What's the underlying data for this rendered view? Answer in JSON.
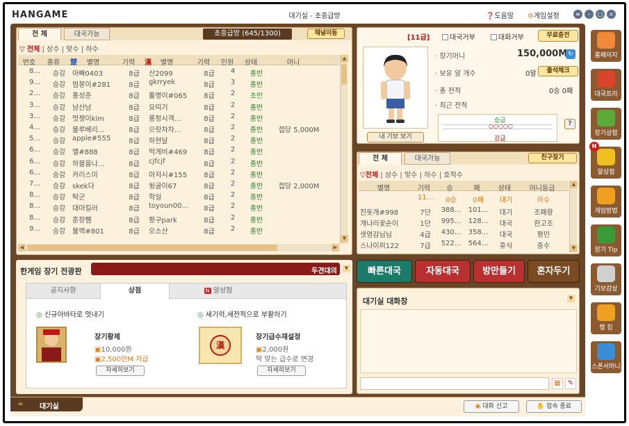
{
  "app": {
    "logo": "HANGAME",
    "title": "대기실 - 초중급방",
    "help": "도움말",
    "settings": "게임설정"
  },
  "lobby": {
    "tab_all": "전 체",
    "tab_available": "대국가능",
    "room_info": "초중급방 (645/1300)",
    "channel_move_btn": "채널이동",
    "filters": [
      "전체",
      "상수",
      "맞수",
      "하수"
    ],
    "headers": [
      "번호",
      "종류",
      "楚",
      "별명",
      "기력",
      "漢",
      "별명",
      "기력",
      "인원",
      "상태",
      "머니"
    ],
    "rows": [
      [
        "8...",
        "승강",
        "아빠0403",
        "8급",
        "산2099",
        "8급",
        "4",
        "종반",
        ""
      ],
      [
        "9...",
        "승강",
        "멈붕이#281",
        "8급",
        "gkrryek",
        "8급",
        "3",
        "종반",
        ""
      ],
      [
        "2...",
        "승강",
        "홍성준",
        "8급",
        "톨명이#065",
        "8급",
        "2",
        "초반",
        ""
      ],
      [
        "3...",
        "승강",
        "남산남",
        "8급",
        "요띠기",
        "8급",
        "2",
        "종반",
        ""
      ],
      [
        "3...",
        "승강",
        "멋쟁이kim",
        "8급",
        "룡정시객...",
        "8급",
        "2",
        "종반",
        ""
      ],
      [
        "4...",
        "승강",
        "볼루베리...",
        "8급",
        "으랏차차...",
        "8급",
        "2",
        "종반",
        "접당 5,000M"
      ],
      [
        "5...",
        "승강",
        "apple#555",
        "8급",
        "하현달",
        "8급",
        "2",
        "종반",
        ""
      ],
      [
        "6...",
        "승강",
        "엘#888",
        "8급",
        "먹게비#469",
        "8급",
        "2",
        "종반",
        ""
      ],
      [
        "6...",
        "승강",
        "하블을나...",
        "8급",
        "cjfcjf",
        "8급",
        "2",
        "종반",
        ""
      ],
      [
        "6...",
        "승강",
        "카리스미",
        "8급",
        "아저시#155",
        "8급",
        "2",
        "종반",
        ""
      ],
      [
        "7...",
        "승강",
        "skek다",
        "8급",
        "뒹굴이67",
        "8급",
        "2",
        "종반",
        "접당 2,000M"
      ],
      [
        "8...",
        "승강",
        "탁군",
        "8급",
        "학일",
        "8급",
        "2",
        "종반",
        ""
      ],
      [
        "8...",
        "승강",
        "대마킬러",
        "8급",
        "toyoun00...",
        "8급",
        "2",
        "종반",
        ""
      ],
      [
        "8...",
        "승강",
        "훈장쨈",
        "8급",
        "팡구park",
        "8급",
        "2",
        "종반",
        ""
      ],
      [
        "9...",
        "승강",
        "불랙#801",
        "8급",
        "오소산",
        "8급",
        "2",
        "종반",
        ""
      ]
    ]
  },
  "profile": {
    "rank": "[11급]",
    "no_game": "대국거부",
    "no_chat": "대화거부",
    "free_charge": "무료충전",
    "money_label": "장기머니",
    "money_value": "150,000M",
    "egg_label": "보유 알 개수",
    "egg_value": "0알",
    "attendance": "출석체크",
    "total_label": "총 전적",
    "total_value": "0승 0패",
    "recent_label": "최근 전적",
    "my_info": "내 기보 보기",
    "promote": "승급",
    "demote": "강급",
    "q": "?"
  },
  "users": {
    "tab_all": "전 체",
    "tab_available": "대국가능",
    "find_friend": "친구찾기",
    "filters": [
      "전체",
      "상수",
      "맞수",
      "하수",
      "호적수"
    ],
    "headers": [
      "별명",
      "기력",
      "승",
      "패",
      "상태",
      "머니등급"
    ],
    "self_row": [
      "",
      "11...",
      "0승",
      "0패",
      "대기",
      "하수"
    ],
    "rows": [
      [
        "진돗개#998",
        "7단",
        "388...",
        "101...",
        "대기",
        "조패왕"
      ],
      [
        "개나리꽃순이",
        "1단",
        "995...",
        "128...",
        "대국",
        "한고조"
      ],
      [
        "샛영감님님",
        "4급",
        "430...",
        "358...",
        "대국",
        "평민"
      ],
      [
        "스나이퍼122",
        "7급",
        "522...",
        "564...",
        "휴식",
        "중수"
      ]
    ]
  },
  "actions": {
    "quick": "빠른대국",
    "auto": "자동대국",
    "make_room": "방만들기",
    "solo": "혼자두기"
  },
  "chat": {
    "title": "대기실 대화창"
  },
  "board": {
    "title": "한게임 장기 전광판",
    "ticker": "두견대의",
    "tabs": [
      "공지사항",
      "상점",
      "알상점"
    ],
    "promo1": "신규아바타로 멋내기",
    "promo2": "새기력,새전적으로 부활하기",
    "item1": {
      "name": "장기황제",
      "price": "10,000원",
      "price2": "2,500만M 지급",
      "detail": "자세히보기"
    },
    "item2": {
      "name": "장기급수재설정",
      "price": "2,000원",
      "desc": "딱 맞는 급수로 변경",
      "detail": "자세히보기"
    }
  },
  "sidebar": [
    "홈페이지",
    "대국프리",
    "장기상점",
    "알상점",
    "게임방법",
    "장기 Tip",
    "기보감상",
    "랭 킹",
    "스폰서머니"
  ],
  "bottom": {
    "lobby": "대기실",
    "report": "대화 신고",
    "exit": "접속 종료"
  }
}
